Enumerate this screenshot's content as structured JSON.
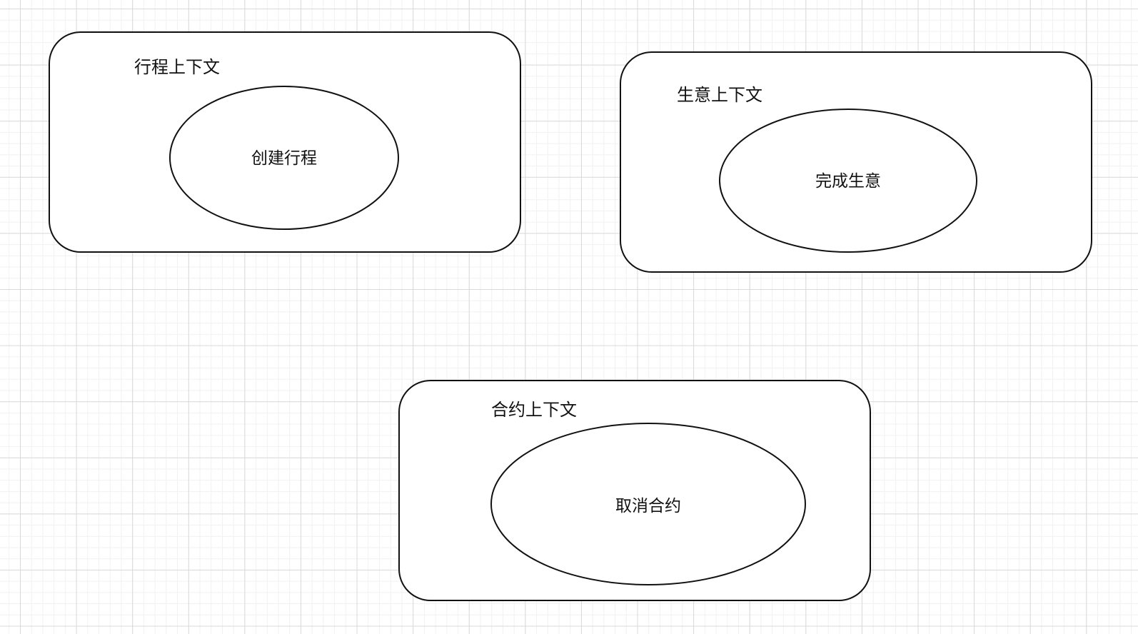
{
  "contexts": [
    {
      "title": "行程上下文",
      "operation": "创建行程"
    },
    {
      "title": "生意上下文",
      "operation": "完成生意"
    },
    {
      "title": "合约上下文",
      "operation": "取消合约"
    }
  ],
  "colors": {
    "stroke": "#111111",
    "grid_major": "#d9d9d9",
    "grid_minor": "#f1f1f1",
    "background": "#ffffff"
  }
}
